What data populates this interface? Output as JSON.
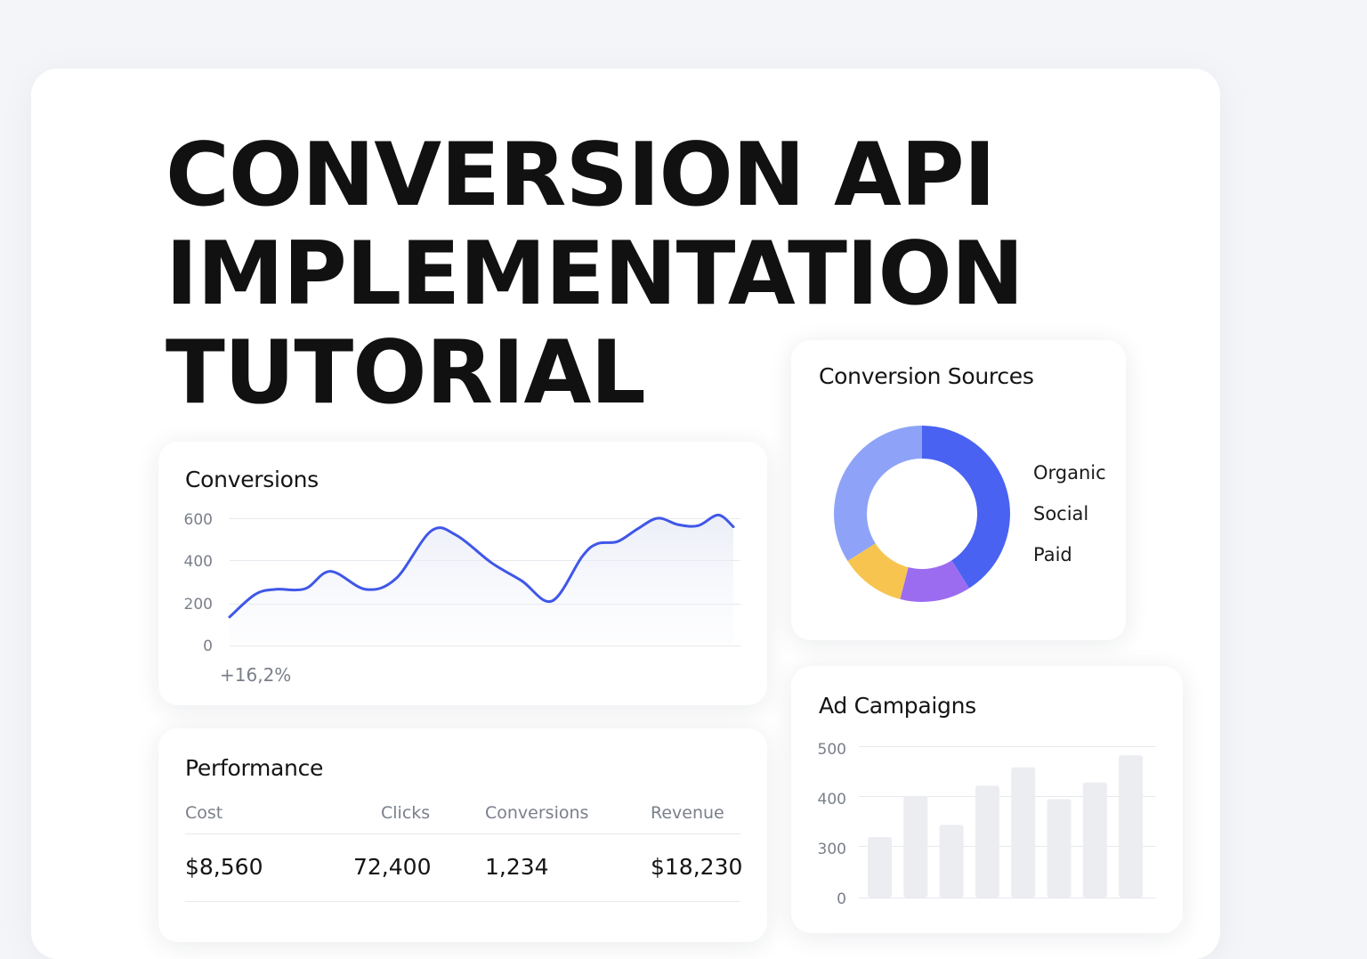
{
  "hero": {
    "title_lines": [
      "CONVERSION API",
      "IMPLEMENTATION",
      "TUTORIAL"
    ]
  },
  "conversions_card": {
    "title": "Conversions",
    "change_text": "+16,2%",
    "line_color": "#3f57e8",
    "chart_data": {
      "type": "line",
      "title": "Conversions",
      "y_ticks": [
        "600",
        "400",
        "200",
        "0"
      ],
      "ylim": [
        0,
        650
      ],
      "grid": true,
      "series": [
        {
          "x": [
            0,
            0.05,
            0.09,
            0.15,
            0.2,
            0.27,
            0.33,
            0.4,
            0.45,
            0.52,
            0.58,
            0.64,
            0.7,
            0.73,
            0.77,
            0.81,
            0.85,
            0.89,
            0.93,
            0.97,
            1.0
          ],
          "values": [
            135,
            240,
            265,
            268,
            350,
            265,
            315,
            540,
            520,
            390,
            305,
            210,
            420,
            480,
            490,
            550,
            600,
            570,
            565,
            615,
            560
          ]
        }
      ]
    }
  },
  "sources_card": {
    "title": "Conversion Sources",
    "chart_data": {
      "type": "pie",
      "title": "Conversion Sources",
      "legend": [
        "Organic",
        "Social",
        "Paid"
      ],
      "legend_position": "right",
      "slices": [
        {
          "value": 41,
          "color": "#4a62f2"
        },
        {
          "value": 13,
          "color": "#9b6cf0"
        },
        {
          "value": 12,
          "color": "#f7c54f"
        },
        {
          "value": 34,
          "color": "#8ea3f7"
        }
      ]
    }
  },
  "campaigns_card": {
    "title": "Ad Campaigns",
    "bar_color": "#ecedf1",
    "chart_data": {
      "type": "bar",
      "title": "Ad Campaigns",
      "y_ticks": [
        "500",
        "400",
        "300",
        "0"
      ],
      "grid": true,
      "values": [
        200,
        335,
        240,
        370,
        430,
        325,
        380,
        470
      ]
    }
  },
  "performance_card": {
    "title": "Performance",
    "columns": [
      "Cost",
      "Clicks",
      "Conversions",
      "Revenue"
    ],
    "values": [
      "$8,560",
      "72,400",
      "1,234",
      "$18,230"
    ]
  }
}
